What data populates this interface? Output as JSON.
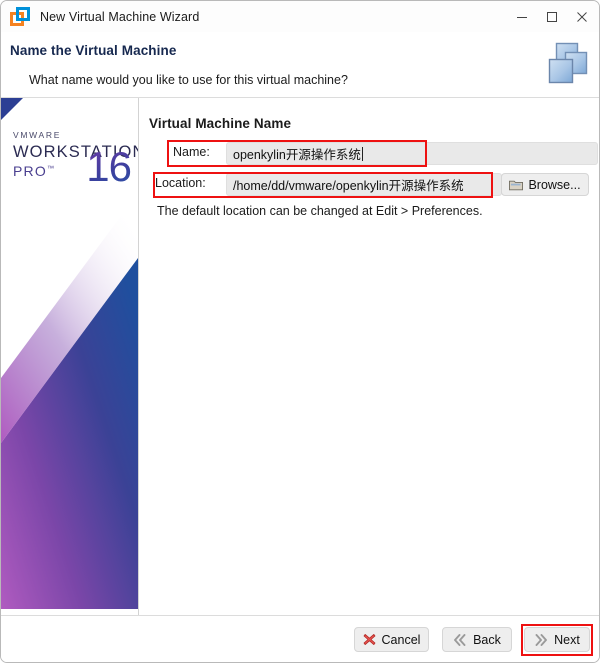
{
  "window": {
    "title": "New Virtual Machine Wizard",
    "icon": "vmware-logo-icon",
    "controls": {
      "minimize": "minimize-icon",
      "maximize": "maximize-icon",
      "close": "close-icon"
    }
  },
  "header": {
    "title": "Name the Virtual Machine",
    "subtitle": "What name would you like to use for this virtual machine?",
    "icon": "stacked-windows-icon"
  },
  "sidebar": {
    "vendor": "VMWARE",
    "product": "WORKSTATION",
    "edition": "PRO",
    "trademark": "™",
    "version": "16"
  },
  "main": {
    "section_heading": "Virtual Machine Name",
    "name_field": {
      "label": "Name:",
      "value": "openkylin开源操作系统",
      "placeholder": ""
    },
    "location_field": {
      "label": "Location:",
      "value": "/home/dd/vmware/openkylin开源操作系统",
      "placeholder": ""
    },
    "browse_button": {
      "label": "Browse...",
      "icon": "folder-icon"
    },
    "hint": "The default location can be changed at Edit > Preferences."
  },
  "footer": {
    "cancel": {
      "label": "Cancel",
      "icon": "red-x-icon"
    },
    "back": {
      "label": "Back",
      "icon": "chevron-left-icon"
    },
    "next": {
      "label": "Next",
      "icon": "chevron-right-icon"
    }
  },
  "annotations": {
    "color": "#ee1111",
    "highlighted": [
      "name-field",
      "location-field",
      "next-button"
    ]
  },
  "colors": {
    "header_title": "#16284f",
    "brand_purple": "#6d3ca8",
    "brand_blue": "#2c3f94",
    "accent_orange": "#f58220",
    "accent_cyan": "#0091da",
    "annotation_red": "#ee1111"
  }
}
